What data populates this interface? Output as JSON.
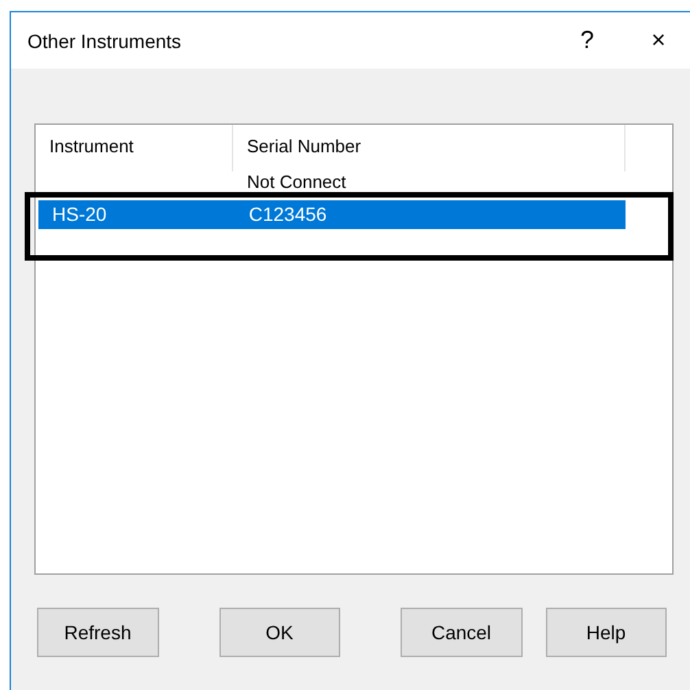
{
  "window": {
    "title": "Other Instruments",
    "help": "?",
    "close": "×"
  },
  "list": {
    "columns": [
      "Instrument",
      "Serial Number"
    ],
    "rows": [
      {
        "serial_number": "Not Connect",
        "selected": false
      },
      {
        "instrument": "HS-20",
        "serial_number": "C123456",
        "selected": true
      }
    ]
  },
  "highlight": {
    "on": true
  },
  "buttons": [
    "Refresh",
    "OK",
    "Cancel",
    "Help"
  ]
}
